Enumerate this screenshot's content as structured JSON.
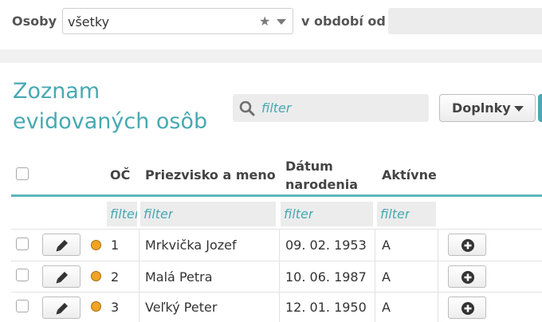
{
  "filterbar": {
    "persons_label": "Osoby",
    "persons_value": "všetky",
    "period_label": "v období od"
  },
  "list": {
    "title": "Zoznam evidovaných osôb",
    "search_placeholder": "filter",
    "addons_label": "Doplnky"
  },
  "table": {
    "columns": {
      "oc": "OČ",
      "name": "Priezvisko a meno",
      "birth_line1": "Dátum",
      "birth_line2": "narodenia",
      "active": "Aktívne"
    },
    "filter_placeholder": "filter",
    "rows": [
      {
        "oc": "1",
        "name": "Mrkvička Jozef",
        "birth": "09. 02. 1953",
        "active": "A"
      },
      {
        "oc": "2",
        "name": "Malá Petra",
        "birth": "10. 06. 1987",
        "active": "A"
      },
      {
        "oc": "3",
        "name": "Veľký Peter",
        "birth": "12. 01. 1950",
        "active": "A"
      }
    ]
  },
  "colors": {
    "accent": "#47a9b3",
    "status_dot": "#f0a324"
  },
  "icons": [
    "star-icon",
    "chevron-down-icon",
    "search-icon",
    "pencil-icon",
    "plus-circle-icon",
    "status-dot-icon"
  ]
}
